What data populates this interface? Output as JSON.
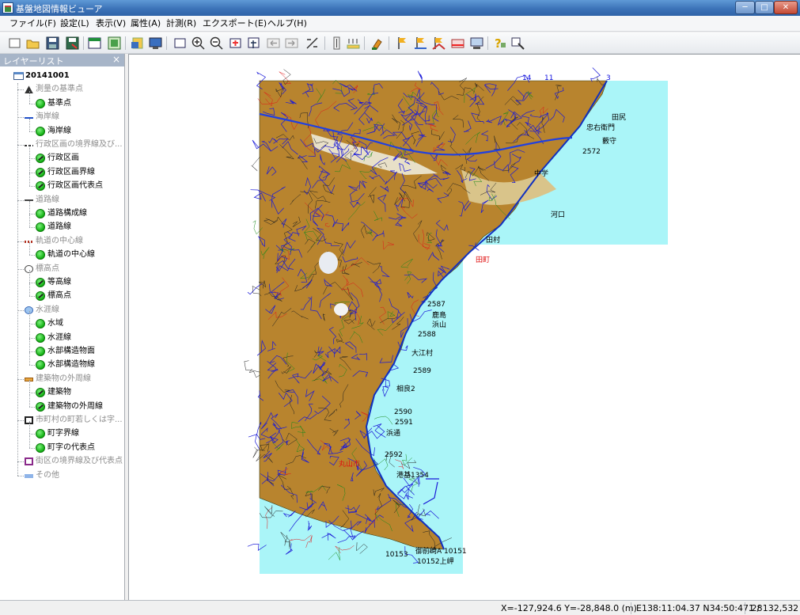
{
  "window": {
    "title": "基盤地図情報ビューア",
    "minimize": "─",
    "maximize": "□",
    "close": "✕"
  },
  "menu": [
    "ファイル(F)",
    "設定(L)",
    "表示(V)",
    "属性(A)",
    "計測(R)",
    "エクスポート(E)",
    "ヘルプ(H)"
  ],
  "toolbar_icons": [
    "new-icon",
    "open-icon",
    "save-icon",
    "save-as-icon",
    "layer-view-icon",
    "map-frame-icon",
    "import-icon",
    "display-icon",
    "select-rect-icon",
    "zoom-in-icon",
    "zoom-out-icon",
    "zoom-rect-icon",
    "pan-icon",
    "back-icon",
    "forward-icon",
    "measure-icon",
    "scale-bar-icon",
    "scale-icon",
    "paint-icon",
    "flag-icon",
    "flag-line-icon",
    "flag-area-icon",
    "red-line-icon",
    "monitor-icon",
    "help-icon",
    "settings-icon"
  ],
  "layer_panel": {
    "title": "レイヤーリスト",
    "close": "×",
    "root": "20141001",
    "groups": [
      {
        "label": "測量の基準点",
        "icon": "triangle-point-icon",
        "items": [
          "基準点"
        ]
      },
      {
        "label": "海岸線",
        "icon": "coastline-icon",
        "items": [
          "海岸線"
        ]
      },
      {
        "label": "行政区画の境界線及び...",
        "icon": "boundary-icon",
        "items": [
          "行政区画",
          "行政区画界線",
          "行政区画代表点"
        ]
      },
      {
        "label": "道路線",
        "icon": "road-icon",
        "items": [
          "道路構成線",
          "道路線"
        ]
      },
      {
        "label": "軌道の中心線",
        "icon": "railway-icon",
        "items": [
          "軌道の中心線"
        ]
      },
      {
        "label": "標高点",
        "icon": "elevation-icon",
        "items": [
          "等高線",
          "標高点"
        ]
      },
      {
        "label": "水涯線",
        "icon": "water-icon",
        "items": [
          "水域",
          "水涯線",
          "水部構造物面",
          "水部構造物線"
        ]
      },
      {
        "label": "建築物の外周線",
        "icon": "building-icon",
        "items": [
          "建築物",
          "建築物の外周線"
        ]
      },
      {
        "label": "市町村の町若しくは字...",
        "icon": "town-icon",
        "items": [
          "町字界線",
          "町字の代表点"
        ]
      },
      {
        "label": "街区の境界線及び代表点",
        "icon": "block-icon",
        "items": []
      },
      {
        "label": "その他",
        "icon": "other-icon",
        "items": []
      }
    ]
  },
  "map": {
    "labels": [
      {
        "t": "14",
        "c": "blue"
      },
      {
        "t": "11",
        "c": "blue"
      },
      {
        "t": "3",
        "c": "blue"
      },
      {
        "t": "田尻",
        "c": "black"
      },
      {
        "t": "忠右衛門",
        "c": "black"
      },
      {
        "t": "藪守",
        "c": "black"
      },
      {
        "t": "2572",
        "c": "black"
      },
      {
        "t": "河口",
        "c": "black"
      },
      {
        "t": "中学",
        "c": "black"
      },
      {
        "t": "田村",
        "c": "black"
      },
      {
        "t": "2587",
        "c": "black"
      },
      {
        "t": "鹿島",
        "c": "black"
      },
      {
        "t": "浜山",
        "c": "black"
      },
      {
        "t": "2588",
        "c": "black"
      },
      {
        "t": "大江村",
        "c": "black"
      },
      {
        "t": "2589",
        "c": "black"
      },
      {
        "t": "相良2",
        "c": "black"
      },
      {
        "t": "2590",
        "c": "black"
      },
      {
        "t": "2591",
        "c": "black"
      },
      {
        "t": "浜通",
        "c": "black"
      },
      {
        "t": "2592",
        "c": "black"
      },
      {
        "t": "港基1354",
        "c": "black"
      },
      {
        "t": "10153",
        "c": "black"
      },
      {
        "t": "御前崎A 10151",
        "c": "black"
      },
      {
        "t": "10152上岬",
        "c": "black"
      },
      {
        "t": "田町",
        "c": "red"
      },
      {
        "t": "丸山市",
        "c": "red"
      }
    ],
    "water_color": "#aaf5f8",
    "land_color": "#b8842e",
    "road_color": "#1a1ad8"
  },
  "status": {
    "coords": "X=-127,924.6 Y=-28,848.0 (m)",
    "latlon": "E138:11:04.37 N34:50:47.28",
    "scale": "1 / 132,532"
  }
}
